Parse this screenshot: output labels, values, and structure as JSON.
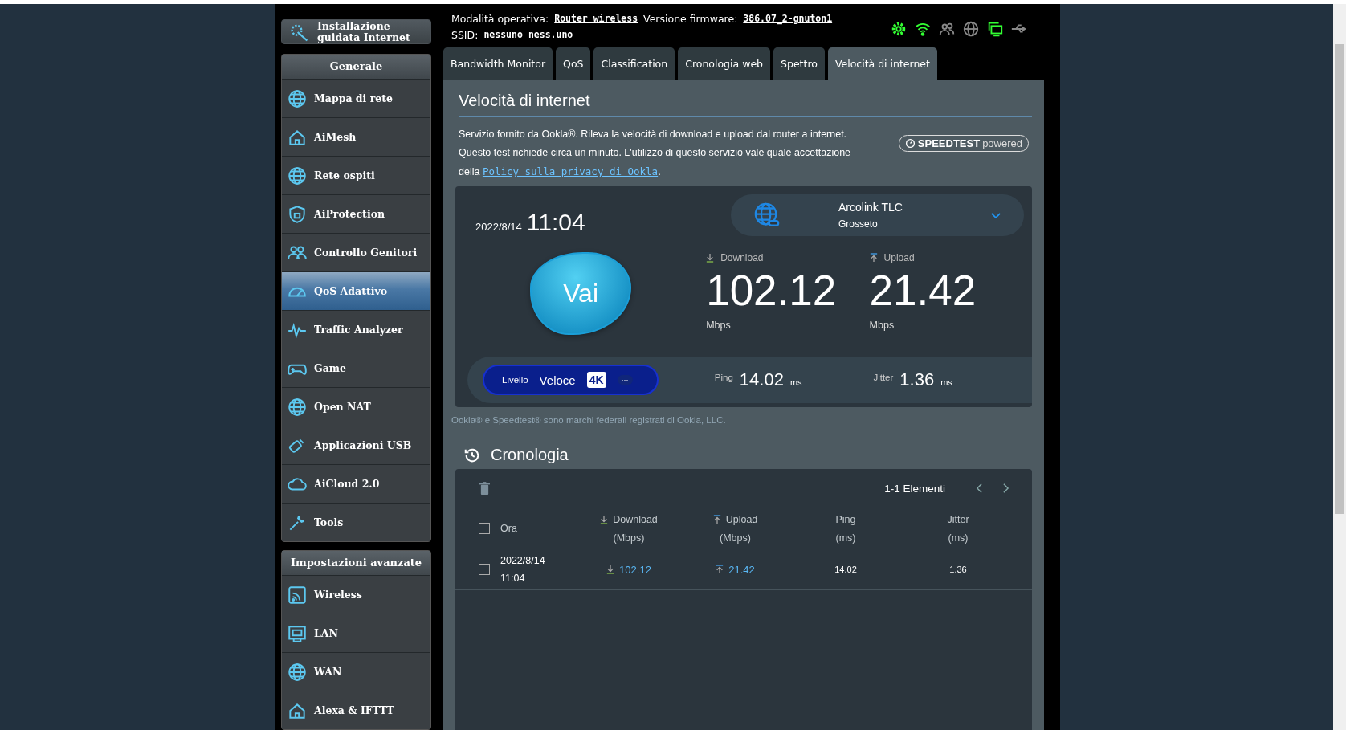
{
  "header": {
    "mode_label": "Modalità operativa:",
    "mode_value": "Router wireless",
    "firmware_label": "Versione firmware:",
    "firmware_value": "386.07_2-gnuton1",
    "ssid_label": "SSID:",
    "ssids": [
      "nessuno",
      "ness.uno"
    ]
  },
  "status_icons": [
    {
      "kind": "gear",
      "on": true
    },
    {
      "kind": "wifi",
      "on": true
    },
    {
      "kind": "people",
      "on": false
    },
    {
      "kind": "globe",
      "on": false
    },
    {
      "kind": "monitor",
      "on": true
    },
    {
      "kind": "usb",
      "on": false
    }
  ],
  "setup_button": "Installazione guidata Internet",
  "sidebar": {
    "general_title": "Generale",
    "general_items": [
      {
        "label": "Mappa di rete",
        "selected": false
      },
      {
        "label": "AiMesh",
        "selected": false
      },
      {
        "label": "Rete ospiti",
        "selected": false
      },
      {
        "label": "AiProtection",
        "selected": false
      },
      {
        "label": "Controllo Genitori",
        "selected": false
      },
      {
        "label": "QoS Adattivo",
        "selected": true
      },
      {
        "label": "Traffic Analyzer",
        "selected": false
      },
      {
        "label": "Game",
        "selected": false
      },
      {
        "label": "Open NAT",
        "selected": false
      },
      {
        "label": "Applicazioni USB",
        "selected": false
      },
      {
        "label": "AiCloud 2.0",
        "selected": false
      },
      {
        "label": "Tools",
        "selected": false
      }
    ],
    "advanced_title": "Impostazioni avanzate",
    "advanced_items": [
      {
        "label": "Wireless",
        "selected": false
      },
      {
        "label": "LAN",
        "selected": false
      },
      {
        "label": "WAN",
        "selected": false
      },
      {
        "label": "Alexa & IFTTT",
        "selected": false
      }
    ]
  },
  "tabs": [
    {
      "label": "Bandwidth Monitor",
      "selected": false
    },
    {
      "label": "QoS",
      "selected": false
    },
    {
      "label": "Classification",
      "selected": false
    },
    {
      "label": "Cronologia web",
      "selected": false
    },
    {
      "label": "Spettro",
      "selected": false
    },
    {
      "label": "Velocità di internet",
      "selected": true
    }
  ],
  "page_title": "Velocità di internet",
  "description": "Servizio fornito da Ookla®. Rileva la velocità di download e upload dal router a internet. Questo test richiede circa un minuto. L'utilizzo di questo servizio vale quale accettazione della",
  "privacy_link": "Policy sulla privacy di Ookla",
  "privacy_suffix": ".",
  "speedtest_badge": {
    "brand": "SPEEDTEST",
    "suffix": "powered"
  },
  "result": {
    "date": "2022/8/14",
    "time": "11:04",
    "server_name": "Arcolink TLC",
    "server_city": "Grosseto",
    "go_button": "Vai",
    "download_label": "Download",
    "download_value": "102.12",
    "download_unit": "Mbps",
    "upload_label": "Upload",
    "upload_value": "21.42",
    "upload_unit": "Mbps",
    "level_label": "Livello",
    "level_value": "Veloce",
    "level_badge": "4K",
    "level_more": "···",
    "ping_label": "Ping",
    "ping_value": "14.02",
    "ping_unit": "ms",
    "jitter_label": "Jitter",
    "jitter_value": "1.36",
    "jitter_unit": "ms"
  },
  "trademark_note": "Ookla® e Speedtest® sono marchi federali registrati di Ookla, LLC.",
  "history": {
    "title": "Cronologia",
    "pagination": "1-1 Elementi",
    "select_all_checked": false,
    "columns": [
      {
        "label": "Ora"
      },
      {
        "label": "Download",
        "unit": "(Mbps)",
        "kind": "down"
      },
      {
        "label": "Upload",
        "unit": "(Mbps)",
        "kind": "up"
      },
      {
        "label": "Ping",
        "unit": "(ms)"
      },
      {
        "label": "Jitter",
        "unit": "(ms)"
      }
    ],
    "rows": [
      {
        "checked": false,
        "date": "2022/8/14",
        "time": "11:04",
        "download": "102.12",
        "upload": "21.42",
        "ping": "14.02",
        "jitter": "1.36"
      }
    ]
  }
}
